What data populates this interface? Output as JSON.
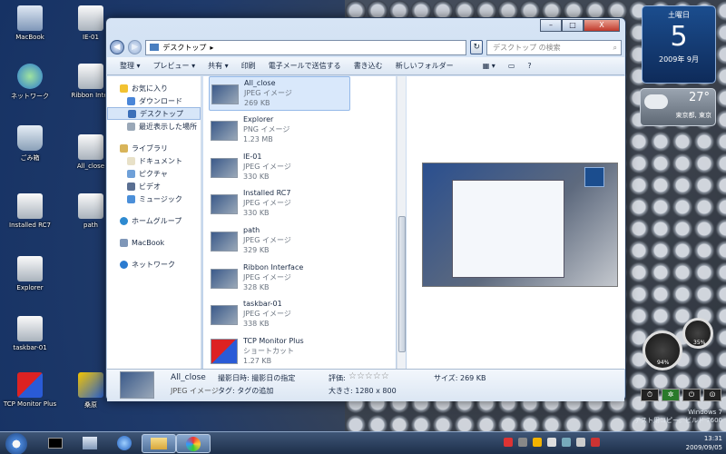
{
  "desktop": {
    "icons": [
      {
        "label": "MacBook"
      },
      {
        "label": "IE-01"
      },
      {
        "label": "ネットワーク"
      },
      {
        "label": "Ribbon Inter"
      },
      {
        "label": "ごみ箱"
      },
      {
        "label": "All_close"
      },
      {
        "label": "Installed RC7"
      },
      {
        "label": "path"
      },
      {
        "label": "Explorer"
      },
      {
        "label": "taskbar-01"
      },
      {
        "label": "TCP Monitor Plus"
      },
      {
        "label": "桑原"
      }
    ]
  },
  "window": {
    "minimize": "–",
    "maximize": "□",
    "close": "X",
    "address": {
      "folder": "デスクトップ",
      "arrow": "▸"
    },
    "search_placeholder": "デスクトップ の検索",
    "toolbar": [
      "整理 ▾",
      "プレビュー ▾",
      "共有 ▾",
      "印刷",
      "電子メールで送信する",
      "書き込む",
      "新しいフォルダー"
    ],
    "nav": {
      "favorites": "お気に入り",
      "fav_items": [
        "ダウンロード",
        "デスクトップ",
        "最近表示した場所"
      ],
      "library": "ライブラリ",
      "lib_items": [
        "ドキュメント",
        "ピクチャ",
        "ビデオ",
        "ミュージック"
      ],
      "homegroup": "ホームグループ",
      "macbook": "MacBook",
      "network": "ネットワーク"
    },
    "files": [
      {
        "name": "All_close",
        "type": "JPEG イメージ",
        "size": "269 KB"
      },
      {
        "name": "Explorer",
        "type": "PNG イメージ",
        "size": "1.23 MB"
      },
      {
        "name": "IE-01",
        "type": "JPEG イメージ",
        "size": "330 KB"
      },
      {
        "name": "Installed RC7",
        "type": "JPEG イメージ",
        "size": "330 KB"
      },
      {
        "name": "path",
        "type": "JPEG イメージ",
        "size": "329 KB"
      },
      {
        "name": "Ribbon Interface",
        "type": "JPEG イメージ",
        "size": "328 KB"
      },
      {
        "name": "taskbar-01",
        "type": "JPEG イメージ",
        "size": "338 KB"
      },
      {
        "name": "TCP Monitor Plus",
        "type": "ショートカット",
        "size": "1.27 KB"
      }
    ],
    "details": {
      "name": "All_close",
      "type": "JPEG イメージ",
      "date": "撮影日時: 撮影日の指定",
      "tags": "タグ: タグの追加",
      "rating_label": "評価:",
      "stars": "☆☆☆☆☆",
      "dimensions": "大きさ: 1280 x 800",
      "size": "サイズ: 269 KB"
    }
  },
  "gadgets": {
    "calendar": {
      "weekday": "土曜日",
      "day": "5",
      "month": "2009年 9月"
    },
    "weather": {
      "temp": "27°",
      "place": "東京都, 東京"
    },
    "cpu": {
      "cpu_pct": "94%",
      "mem_pct": "35%"
    }
  },
  "watermark": {
    "line1": "Windows 7",
    "line2": "テスト用コピー。ビルド 7600"
  },
  "clock": {
    "time": "13:31",
    "date": "2009/09/05"
  }
}
